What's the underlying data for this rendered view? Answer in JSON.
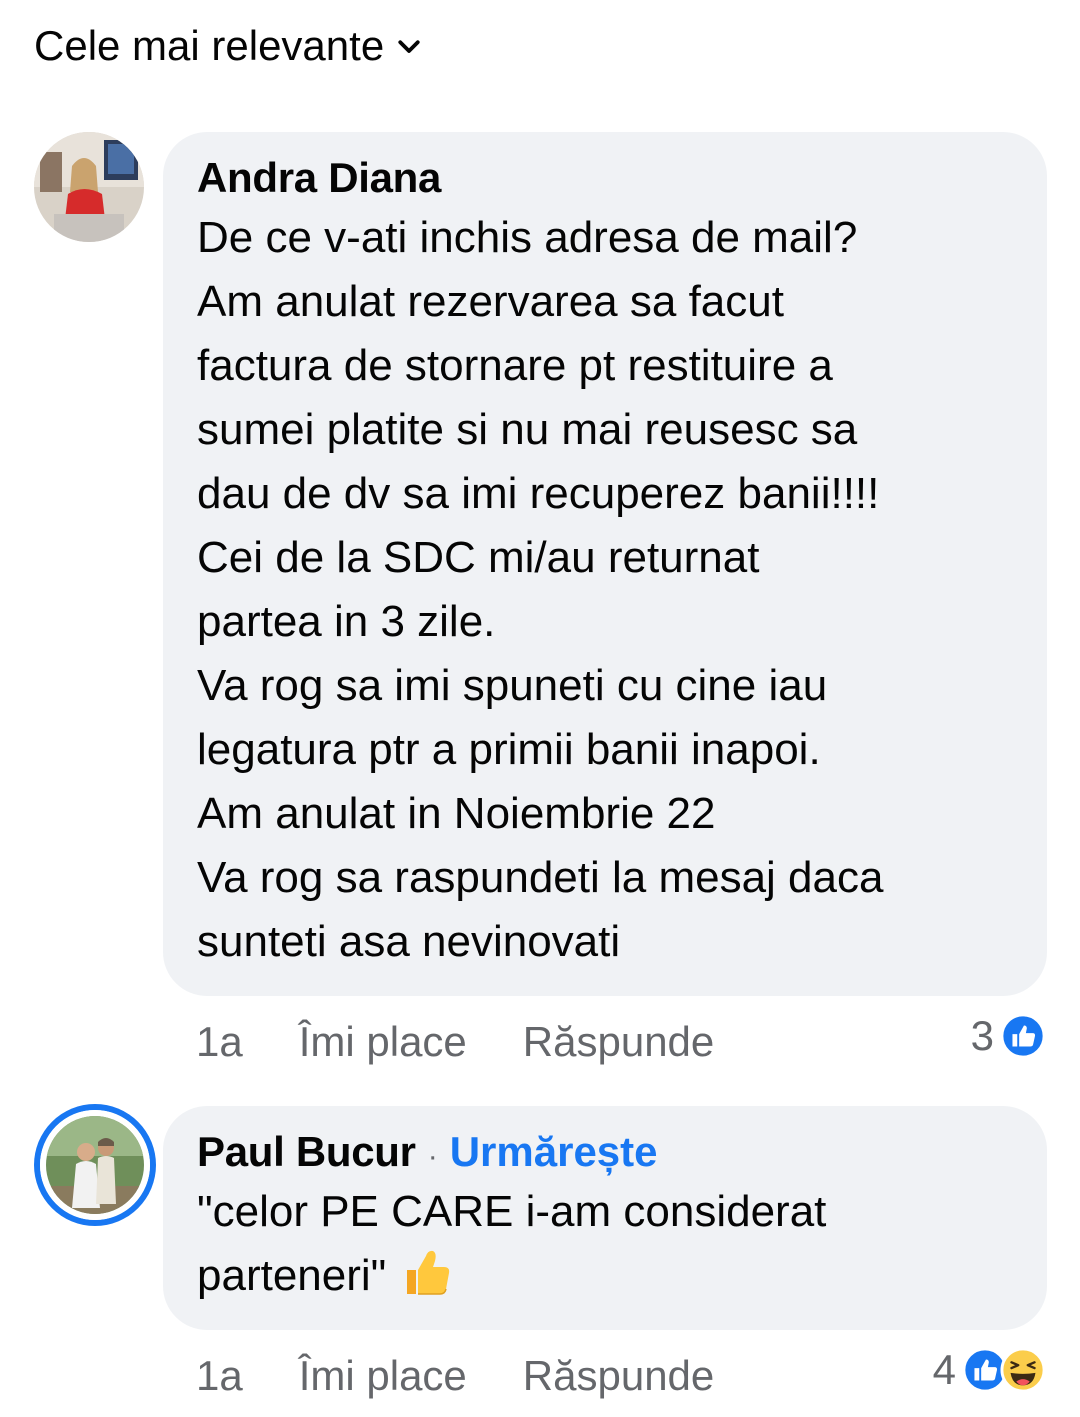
{
  "sort": {
    "label": "Cele mai relevante",
    "icon": "chevron-down-icon"
  },
  "comments": [
    {
      "author": "Andra Diana",
      "text": "De ce v-ati inchis adresa de mail?\nAm anulat rezervarea sa facut\nfactura de stornare pt restituire a\nsumei platite si nu mai reusesc sa\ndau de dv sa imi recuperez banii!!!!\nCei de la SDC mi/au returnat\npartea in 3 zile.\nVa rog sa imi spuneti cu cine iau\nlegatura ptr a primii banii inapoi.\nAm anulat in Noiembrie 22\nVa rog sa raspundeti la mesaj daca\nsunteti asa nevinovati",
      "time": "1a",
      "like_label": "Îmi place",
      "reply_label": "Răspunde",
      "reaction_count": "3",
      "reaction_icons": [
        "like-reaction-icon"
      ]
    },
    {
      "author": "Paul Bucur",
      "separator": "·",
      "follow_label": "Urmărește",
      "text": "\"celor PE CARE i-am considerat\nparteneri\" ",
      "emoji": "thumbs-up-emoji-icon",
      "time": "1a",
      "like_label": "Îmi place",
      "reply_label": "Răspunde",
      "reaction_count": "4",
      "reaction_icons": [
        "like-reaction-icon",
        "haha-reaction-icon"
      ]
    }
  ],
  "colors": {
    "accent": "#1877f2",
    "bubble": "#f0f2f5",
    "meta": "#65676b"
  }
}
